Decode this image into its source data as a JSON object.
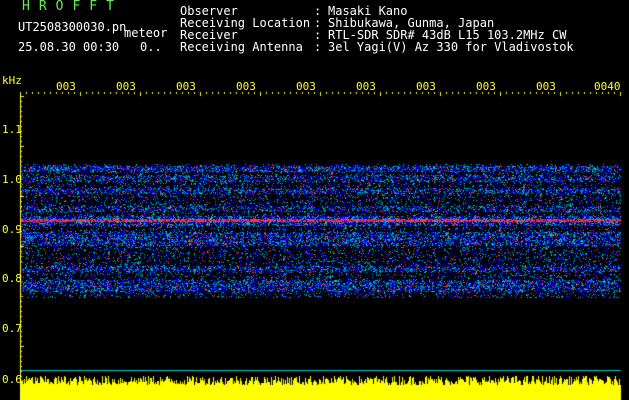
{
  "header": {
    "logo": "HROFFT",
    "file_name": "UT2508300030.pn",
    "meteor_tag": "meteor",
    "timestamp": "25.08.30 00:30",
    "time_extra": "0.."
  },
  "metadata": [
    {
      "label": "Observer",
      "value": "Masaki Kano"
    },
    {
      "label": "Receiving Location",
      "value": "Shibukawa, Gunma, Japan"
    },
    {
      "label": "Receiver",
      "value": "RTL-SDR SDR# 43dB L15 103.2MHz CW"
    },
    {
      "label": "Receiving Antenna",
      "value": "3el Yagi(V) Az 330 for Vladivostok"
    }
  ],
  "spectrogram": {
    "frequency_unit": "kHz",
    "frequency_ticks": [
      "1.1",
      "1.0",
      "0.9",
      "0.8",
      "0.7",
      "0.6"
    ],
    "time_ticks": [
      "003",
      "003",
      "003",
      "003",
      "003",
      "003",
      "003",
      "003",
      "003",
      "0040"
    ],
    "colors": {
      "background": "#000000",
      "tick_label": "#ffff33",
      "signal_low": "#0000ff",
      "signal_mid": "#00c8c8",
      "signal_high": "#ff3050",
      "amplitude_trace": "#ffff00"
    }
  }
}
